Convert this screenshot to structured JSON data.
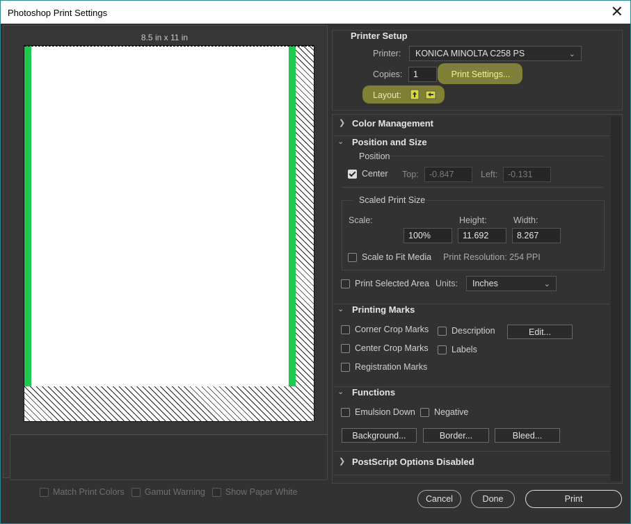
{
  "window": {
    "title": "Photoshop Print Settings",
    "close_glyph": "✕"
  },
  "preview": {
    "paper_size": "8.5 in x 11 in"
  },
  "bottom_options": [
    "Match Print Colors",
    "Gamut Warning",
    "Show Paper White"
  ],
  "printer_setup": {
    "heading": "Printer Setup",
    "printer_label": "Printer:",
    "printer_value": "KONICA MINOLTA C258 PS",
    "copies_label": "Copies:",
    "copies_value": "1",
    "print_settings_button": "Print Settings...",
    "layout_label": "Layout:",
    "layout_icons": [
      "portrait-layout-icon",
      "landscape-layout-icon"
    ]
  },
  "sections": {
    "color_management": "Color Management",
    "position_and_size": "Position and Size",
    "printing_marks": "Printing Marks",
    "functions": "Functions",
    "postscript": "PostScript Options Disabled"
  },
  "position": {
    "group_label": "Position",
    "center_label": "Center",
    "center_checked": true,
    "top_label": "Top:",
    "top_value": "-0.847",
    "left_label": "Left:",
    "left_value": "-0.131"
  },
  "scaled": {
    "group_label": "Scaled Print Size",
    "scale_label": "Scale:",
    "height_label": "Height:",
    "width_label": "Width:",
    "scale_value": "100%",
    "height_value": "11.692",
    "width_value": "8.267",
    "fit_label": "Scale to Fit Media",
    "resolution": "Print Resolution: 254 PPI"
  },
  "selected_area": {
    "label": "Print Selected Area",
    "units_label": "Units:",
    "units_value": "Inches"
  },
  "marks": {
    "corner": "Corner Crop Marks",
    "center": "Center Crop Marks",
    "registration": "Registration Marks",
    "description": "Description",
    "labels": "Labels",
    "edit_button": "Edit..."
  },
  "functions": {
    "emulsion": "Emulsion Down",
    "negative": "Negative",
    "background_button": "Background...",
    "border_button": "Border...",
    "bleed_button": "Bleed..."
  },
  "footer": {
    "cancel": "Cancel",
    "done": "Done",
    "print": "Print"
  },
  "colors": {
    "highlight": "#eeee3c",
    "crop_green": "#1ec94f",
    "background": "#323232"
  }
}
